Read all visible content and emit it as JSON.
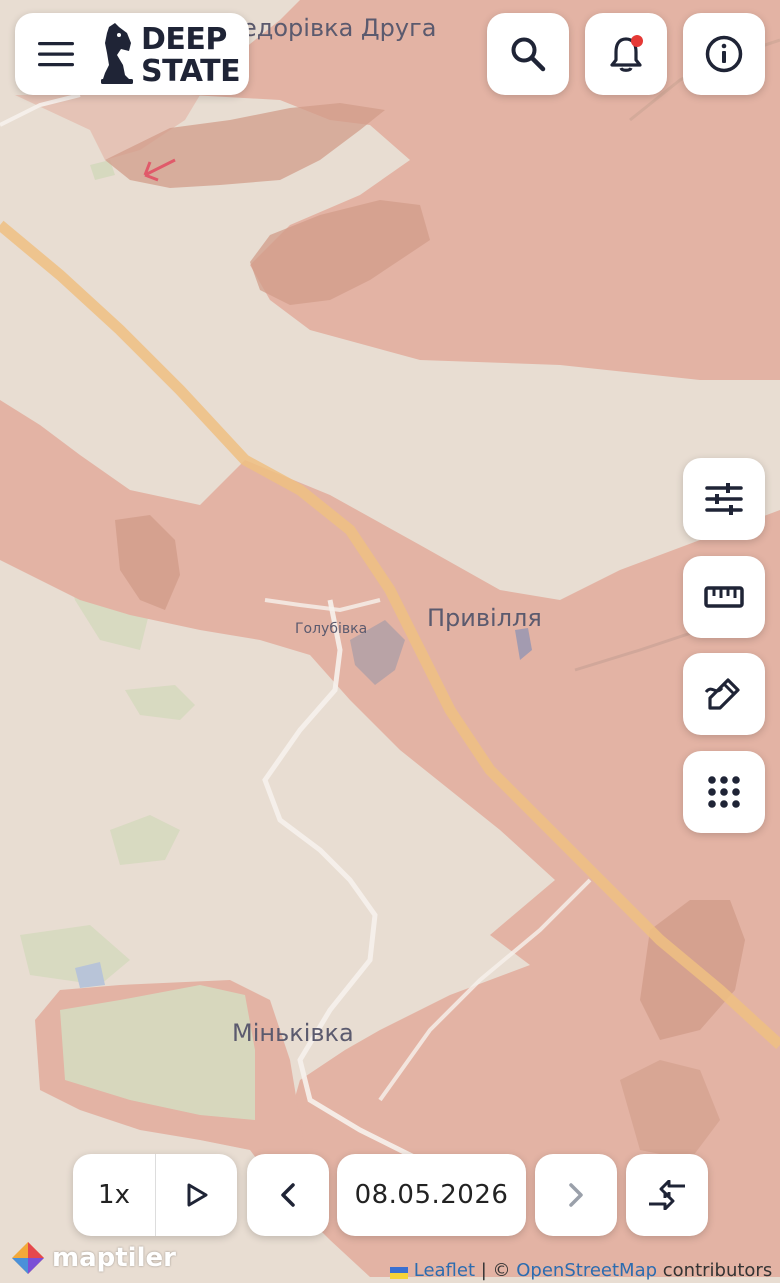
{
  "brand": {
    "line1": "DEEP",
    "line2": "STATE"
  },
  "map": {
    "labels": {
      "fedorivka": "едорівка Друга",
      "pryvillia": "Привілля",
      "holubivka": "Голубівка",
      "minkivka": "Міньківка"
    },
    "colors": {
      "base": "#e8ddd2",
      "occupied": "#e3b3a4",
      "occupied_dark": "#d19c8a",
      "forest": "#d6d9bf",
      "road": "#efc083",
      "minor_road": "#f6f1ec",
      "water": "#b9b0c4"
    }
  },
  "controls": {
    "search_icon": "search-icon",
    "bell_icon": "bell-icon",
    "info_icon": "info-icon",
    "side_icons": [
      "sliders-icon",
      "ruler-icon",
      "draw-icon",
      "grid-icon"
    ]
  },
  "timeline": {
    "speed": "1x",
    "date": "08.05.2026"
  },
  "attribution": {
    "leaflet": "Leaflet",
    "separator": " | © ",
    "osm": "OpenStreetMap",
    "contributors": " contributors",
    "maptiler": "maptiler"
  }
}
